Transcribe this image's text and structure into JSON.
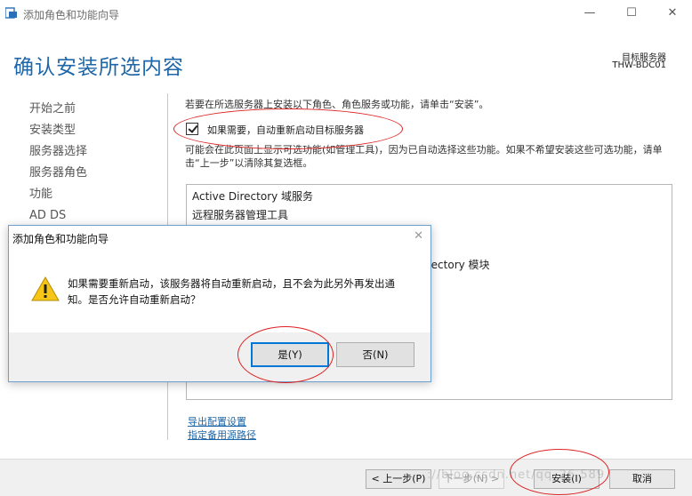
{
  "window": {
    "title": "添加角色和功能向导",
    "minimize_glyph": "—",
    "maximize_glyph": "☐",
    "close_glyph": "✕"
  },
  "header": {
    "heading": "确认安装所选内容",
    "target_label": "目标服务器",
    "target_server": "THW-BDC01"
  },
  "nav": {
    "items": [
      "开始之前",
      "安装类型",
      "服务器选择",
      "服务器角色",
      "功能",
      "AD DS"
    ]
  },
  "main": {
    "intro": "若要在所选服务器上安装以下角色、角色服务或功能，请单击“安装”。",
    "restart_checkbox_label": "如果需要，自动重新启动目标服务器",
    "restart_checked": true,
    "note": "可能会在此页面上显示可选功能(如管理工具)，因为已自动选择这些功能。如果不希望安装这些可选功能，请单击“上一步”以清除其复选框。",
    "list": [
      "Active Directory 域服务",
      "远程服务器管理工具",
      "rectory 模块"
    ],
    "links": [
      "导出配置设置",
      "指定备用源路径"
    ]
  },
  "footer": {
    "prev": "< 上一步(P)",
    "next": "下一步(N) >",
    "install": "安装(I)",
    "cancel": "取消"
  },
  "dialog": {
    "title": "添加角色和功能向导",
    "close_glyph": "✕",
    "message": "如果需要重新启动，该服务器将自动重新启动，且不会为此另外再发出通知。是否允许自动重新启动？",
    "yes": "是(Y)",
    "no": "否(N)"
  },
  "watermark": "://blog.csdn.net/qq_26   589",
  "colors": {
    "heading": "#1e66a8",
    "annotation": "#dd2222",
    "accent": "#0078d7"
  }
}
